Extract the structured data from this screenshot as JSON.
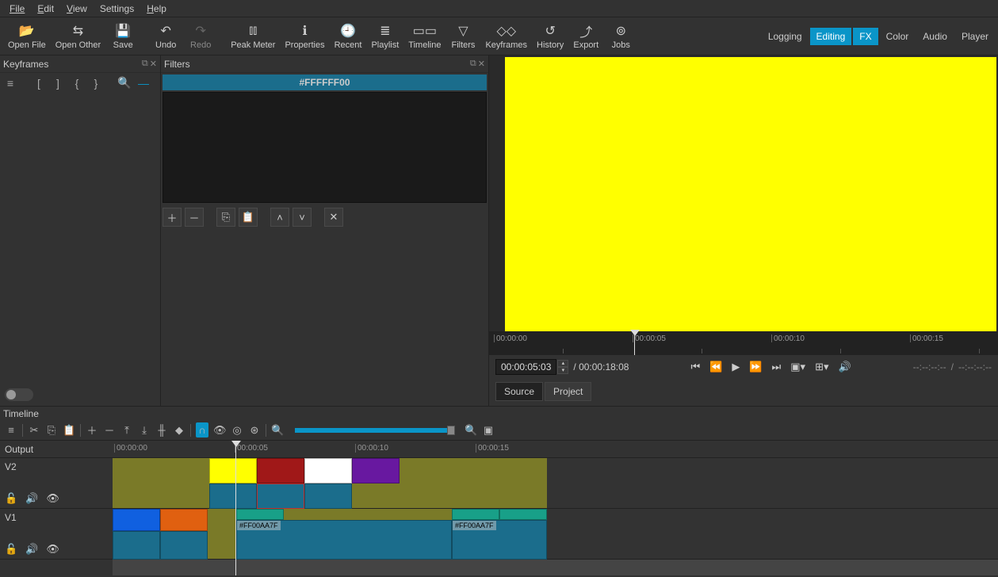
{
  "menu": {
    "file": "File",
    "edit": "Edit",
    "view": "View",
    "settings": "Settings",
    "help": "Help"
  },
  "toolbar": {
    "open_file": "Open File",
    "open_other": "Open Other",
    "save": "Save",
    "undo": "Undo",
    "redo": "Redo",
    "peak_meter": "Peak Meter",
    "properties": "Properties",
    "recent": "Recent",
    "playlist": "Playlist",
    "timeline": "Timeline",
    "filters": "Filters",
    "keyframes": "Keyframes",
    "history": "History",
    "export": "Export",
    "jobs": "Jobs"
  },
  "layout": {
    "logging": "Logging",
    "editing": "Editing",
    "fx": "FX",
    "color": "Color",
    "audio": "Audio",
    "player": "Player"
  },
  "panels": {
    "keyframes": "Keyframes",
    "filters": "Filters",
    "timeline": "Timeline"
  },
  "filter": {
    "selected": "#FFFFFF00"
  },
  "player": {
    "current_tc": "00:00:05:03",
    "duration": "/ 00:00:18:08",
    "tc_in": "--:--:--:--",
    "tc_sep": "/",
    "tc_out": "--:--:--:--",
    "source": "Source",
    "project": "Project",
    "ticks": [
      "00:00:00",
      "00:00:05",
      "00:00:10",
      "00:00:15"
    ]
  },
  "timeline": {
    "output": "Output",
    "ticks": [
      "00:00:00",
      "00:00:05",
      "00:00:10",
      "00:00:15"
    ],
    "v2": "V2",
    "v1": "V1",
    "clip_label_a": "#FF00AA7F",
    "clip_label_b": "#FF00AA7F"
  }
}
